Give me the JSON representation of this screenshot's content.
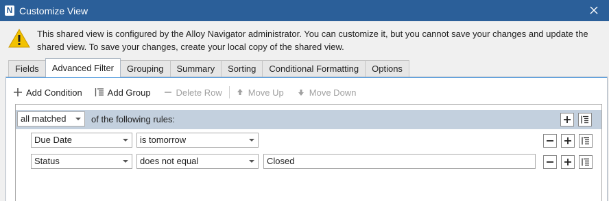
{
  "window": {
    "title": "Customize View",
    "app_icon_letter": "N"
  },
  "notice": {
    "text": "This shared view is configured by the Alloy Navigator administrator. You can customize it, but you cannot save your changes and update the shared view. To save your changes, create your local copy of the shared view."
  },
  "tabs": [
    {
      "label": "Fields"
    },
    {
      "label": "Advanced Filter"
    },
    {
      "label": "Grouping"
    },
    {
      "label": "Summary"
    },
    {
      "label": "Sorting"
    },
    {
      "label": "Conditional Formatting"
    },
    {
      "label": "Options"
    }
  ],
  "active_tab": "Advanced Filter",
  "toolbar": {
    "add_condition": "Add Condition",
    "add_group": "Add Group",
    "delete_row": "Delete Row",
    "move_up": "Move Up",
    "move_down": "Move Down"
  },
  "filter": {
    "match_mode": "all matched",
    "rules_label": "of the following rules:",
    "rows": [
      {
        "field": "Due Date",
        "operator": "is tomorrow",
        "value": ""
      },
      {
        "field": "Status",
        "operator": "does not equal",
        "value": "Closed"
      }
    ]
  },
  "colors": {
    "titlebar": "#2b5f99",
    "rules_header": "#c3d0de",
    "warning": "#f2c200"
  }
}
